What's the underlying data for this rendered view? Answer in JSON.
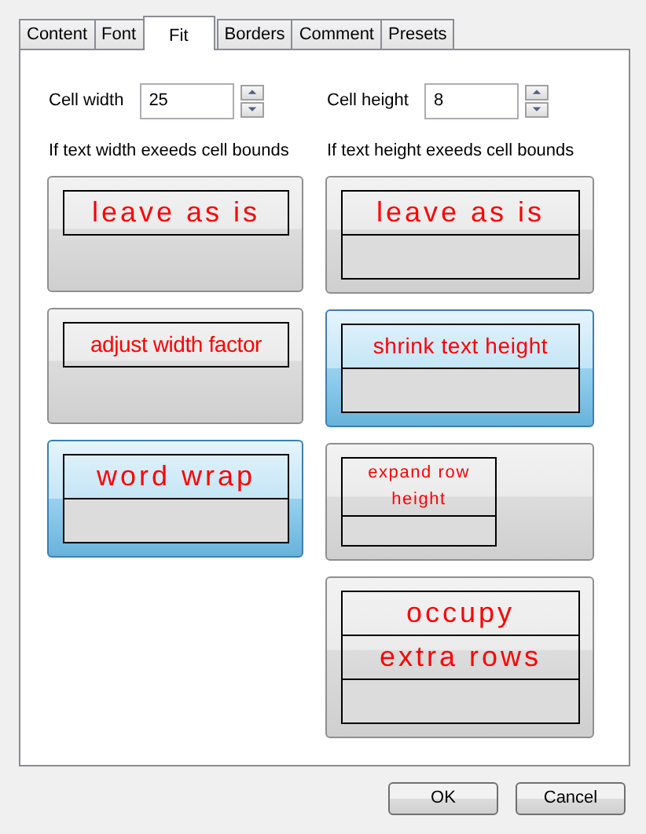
{
  "tabs": [
    {
      "label": "Content",
      "selected": false
    },
    {
      "label": "Font",
      "selected": false
    },
    {
      "label": "Fit",
      "selected": true
    },
    {
      "label": "Borders",
      "selected": false
    },
    {
      "label": "Comment",
      "selected": false
    },
    {
      "label": "Presets",
      "selected": false
    }
  ],
  "columns": [
    {
      "field_label": "Cell width",
      "value": "25",
      "heading": "If text width exeeds cell bounds",
      "options": [
        {
          "kind": "single",
          "rows": [
            "leave as is"
          ],
          "blank_row": false,
          "selected": false
        },
        {
          "kind": "fit-width",
          "rows": [
            "adjust width factor"
          ],
          "blank_row": false,
          "selected": false
        },
        {
          "kind": "single",
          "rows": [
            "word wrap"
          ],
          "blank_row": true,
          "selected": true
        }
      ]
    },
    {
      "field_label": "Cell height",
      "value": "8",
      "heading": "If text height exeeds cell bounds",
      "options": [
        {
          "kind": "single",
          "rows": [
            "leave as is"
          ],
          "blank_row": true,
          "selected": false
        },
        {
          "kind": "shrink",
          "rows": [
            "shrink text height"
          ],
          "blank_row": true,
          "selected": true
        },
        {
          "kind": "expand",
          "rows": [
            "expand row height"
          ],
          "blank_row": true,
          "selected": false
        },
        {
          "kind": "single",
          "rows": [
            "occupy",
            "extra rows"
          ],
          "blank_row": true,
          "selected": false
        }
      ]
    }
  ],
  "buttons": [
    "OK",
    "Cancel"
  ]
}
